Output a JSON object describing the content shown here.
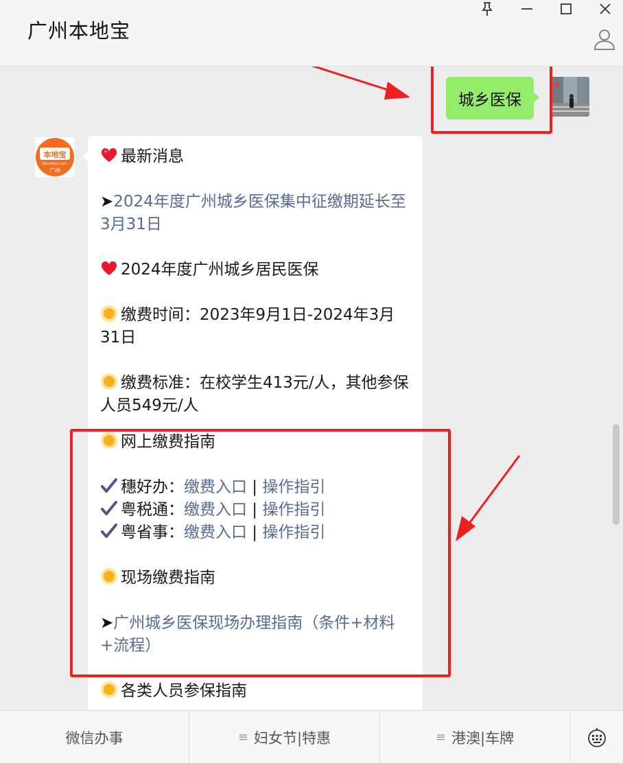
{
  "window": {
    "title": "广州本地宝",
    "pin": "⚲",
    "minimize": "—",
    "maximize": "☐",
    "close": "✕"
  },
  "user_message": {
    "text": "城乡医保"
  },
  "bot_message": {
    "latest_header": "最新消息",
    "arrow": "➤",
    "latest_link": "2024年度广州城乡医保集中征缴期延长至3月31日",
    "heading_2024": "2024年度广州城乡居民医保",
    "pay_time": "缴费时间：2023年9月1日-2024年3月31日",
    "pay_standard": "缴费标准：在校学生413元/人，其他参保人员549元/人",
    "online_guide": "网上缴费指南",
    "services": [
      {
        "name": "穗好办：",
        "entry": "缴费入口",
        "sep": " | ",
        "guide": "操作指引"
      },
      {
        "name": "粤税通：",
        "entry": "缴费入口",
        "sep": " | ",
        "guide": "操作指引"
      },
      {
        "name": "粤省事：",
        "entry": "缴费入口",
        "sep": " | ",
        "guide": "操作指引"
      }
    ],
    "onsite_guide": "现场缴费指南",
    "onsite_link": "广州城乡医保现场办理指南（条件+材料+流程）",
    "next_header": "各类人员参保指南"
  },
  "bot_avatar": {
    "line1": "本地宝",
    "line2": "Bendibao.com",
    "line3": "广州"
  },
  "menu": {
    "item1": "微信办事",
    "item2": "妇女节|特惠",
    "item3": "港澳|车牌",
    "menu_glyph": "≡"
  },
  "colors": {
    "link": "#576b95",
    "user_bubble": "#95ec69",
    "highlight": "#f01f1f",
    "sun_emoji": "#f7b21b",
    "heart": "#e8192c",
    "check": "#5b4f8a"
  },
  "icons": [
    "pin-icon",
    "minimize-icon",
    "maximize-icon",
    "close-icon",
    "profile-icon",
    "heart-icon",
    "sun-icon",
    "check-icon",
    "keyboard-icon"
  ]
}
